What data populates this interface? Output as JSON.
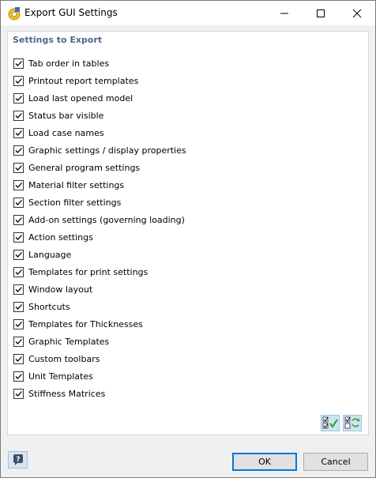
{
  "window": {
    "title": "Export GUI Settings",
    "icon": "app-settings-icon",
    "controls": [
      "minimize-icon",
      "maximize-icon",
      "close-icon"
    ]
  },
  "group": {
    "title": "Settings to Export",
    "items": [
      {
        "label": "Tab order in tables",
        "checked": true
      },
      {
        "label": "Printout report templates",
        "checked": true
      },
      {
        "label": "Load last opened model",
        "checked": true
      },
      {
        "label": "Status bar visible",
        "checked": true
      },
      {
        "label": "Load case names",
        "checked": true
      },
      {
        "label": "Graphic settings / display properties",
        "checked": true
      },
      {
        "label": "General program settings",
        "checked": true
      },
      {
        "label": "Material filter settings",
        "checked": true
      },
      {
        "label": "Section filter settings",
        "checked": true
      },
      {
        "label": "Add-on settings (governing loading)",
        "checked": true
      },
      {
        "label": "Action settings",
        "checked": true
      },
      {
        "label": "Language",
        "checked": true
      },
      {
        "label": "Templates for print settings",
        "checked": true
      },
      {
        "label": "Window layout",
        "checked": true
      },
      {
        "label": "Shortcuts",
        "checked": true
      },
      {
        "label": "Templates for Thicknesses",
        "checked": true
      },
      {
        "label": "Graphic Templates",
        "checked": true
      },
      {
        "label": "Custom toolbars",
        "checked": true
      },
      {
        "label": "Unit Templates",
        "checked": true
      },
      {
        "label": "Stiffness Matrices",
        "checked": true
      }
    ]
  },
  "tools": {
    "check_all_icon": "check-all-icon",
    "invert_icon": "invert-selection-icon"
  },
  "footer": {
    "help_icon": "help-icon",
    "ok_label": "OK",
    "cancel_label": "Cancel"
  },
  "colors": {
    "group_title": "#4a6b8a",
    "ok_border": "#0078d7",
    "tool_bg": "#cde4f3"
  }
}
